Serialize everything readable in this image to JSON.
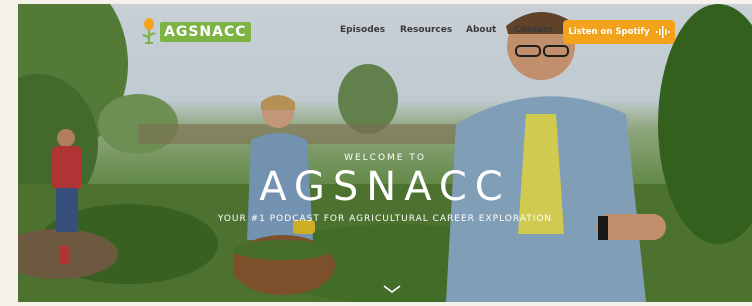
{
  "brand": {
    "name": "AGSNACC",
    "accent": "#7cb342",
    "cta_color": "#f3a21b"
  },
  "nav": {
    "items": [
      {
        "label": "Episodes"
      },
      {
        "label": "Resources"
      },
      {
        "label": "About"
      },
      {
        "label": "Contact"
      }
    ]
  },
  "cta": {
    "label": "Listen on Spotify",
    "icon": "soundwave-icon"
  },
  "hero": {
    "welcome": "WELCOME TO",
    "title": "AGSNACC",
    "tagline": "YOUR #1 PODCAST FOR AGRICULTURAL CAREER EXPLORATION",
    "scroll_icon": "chevron-down-icon"
  }
}
